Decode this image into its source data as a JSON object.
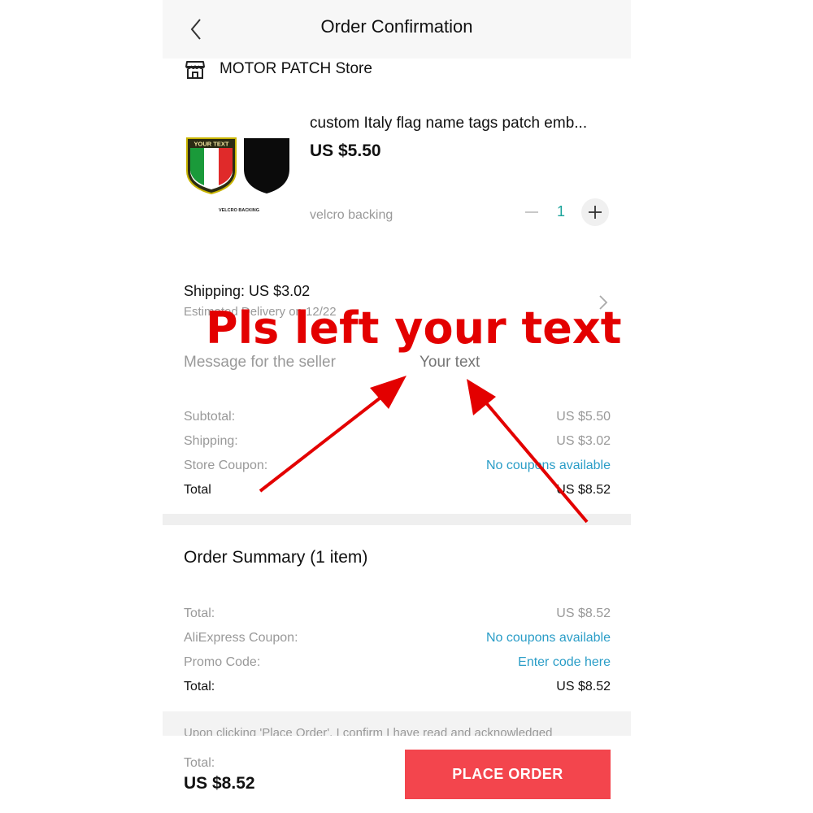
{
  "header": {
    "title": "Order Confirmation",
    "back_icon": "chevron-left-icon"
  },
  "store": {
    "icon": "storefront-icon",
    "name": "MOTOR PATCH Store"
  },
  "product": {
    "name": "custom Italy flag name tags patch emb...",
    "price": "US $5.50",
    "variant": "velcro backing",
    "quantity": "1",
    "image_patch_text": "YOUR TEXT",
    "image_caption": "VELCRO BACKING"
  },
  "shipping": {
    "label": "Shipping: US $3.02",
    "estimated_delivery": "Estimated Delivery on 12/22"
  },
  "message": {
    "label": "Message for the seller",
    "placeholder": "Your text"
  },
  "order_costs": [
    {
      "label": "Subtotal:",
      "value": "US $5.50",
      "style": "muted"
    },
    {
      "label": "Shipping:",
      "value": "US $3.02",
      "style": "muted"
    },
    {
      "label": "Store Coupon:",
      "value": "No coupons available",
      "style": "link"
    },
    {
      "label": "Total",
      "value": "US $8.52",
      "style": "dark"
    }
  ],
  "summary": {
    "title": "Order Summary (1 item)",
    "rows": [
      {
        "label": "Total:",
        "value": "US $8.52",
        "style": "muted"
      },
      {
        "label": "AliExpress Coupon:",
        "value": "No coupons available",
        "style": "link"
      },
      {
        "label": "Promo Code:",
        "value": "Enter code here",
        "style": "link"
      },
      {
        "label": "Total:",
        "value": "US $8.52",
        "style": "dark"
      }
    ]
  },
  "notice": "Upon clicking 'Place Order', I confirm I have read and acknowledged",
  "footer": {
    "total_label": "Total:",
    "total_value": "US $8.52",
    "button_label": "PLACE ORDER"
  },
  "overlay": {
    "caption": "Pls left your text",
    "color": "#e30000"
  },
  "colors": {
    "accent_red": "#f3454d",
    "link_blue": "#2a9dc7",
    "qty_teal": "#1aa39a",
    "muted_gray": "#999999"
  }
}
